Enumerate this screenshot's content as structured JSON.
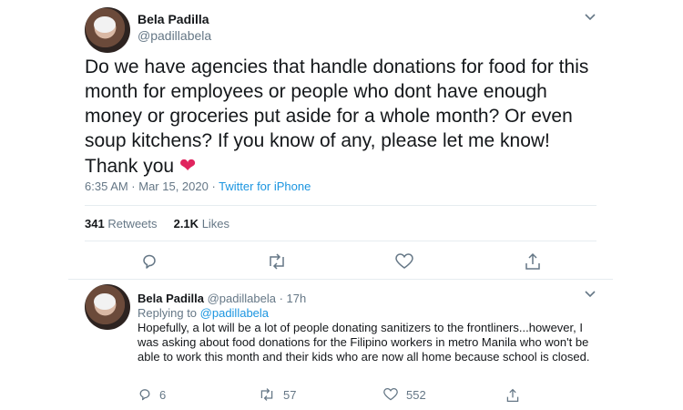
{
  "tweet": {
    "author_name": "Bela Padilla",
    "author_handle": "@padillabela",
    "text": "Do we have agencies that handle donations for food for this month for employees or people who dont have enough money or groceries put aside for a whole month? Or even soup kitchens? If you know of any, please let me know! Thank you",
    "heart_emoji": "❤",
    "timestamp": "6:35 AM · Mar 15, 2020 · ",
    "source": "Twitter for iPhone",
    "retweets_count": "341",
    "retweets_label": "Retweets",
    "likes_count": "2.1K",
    "likes_label": "Likes"
  },
  "reply": {
    "author_name": "Bela Padilla",
    "author_handle": "@padillabela · 17h",
    "replying_prefix": "Replying to ",
    "replying_to": "@padillabela",
    "text": "Hopefully, a lot will be a lot of people donating sanitizers to the frontliners...however, I was asking about food donations for the Filipino workers in metro Manila who won't be able to work this month and their kids who are now all home because school is closed.",
    "reply_count": "6",
    "retweet_count": "57",
    "like_count": "552"
  },
  "icons": {
    "reply": "reply-icon",
    "retweet": "retweet-icon",
    "like": "heart-icon",
    "share": "share-icon",
    "more": "chevron-down-icon"
  },
  "colors": {
    "link": "#1b95e0",
    "heart": "#e0245e",
    "muted": "#657786"
  }
}
